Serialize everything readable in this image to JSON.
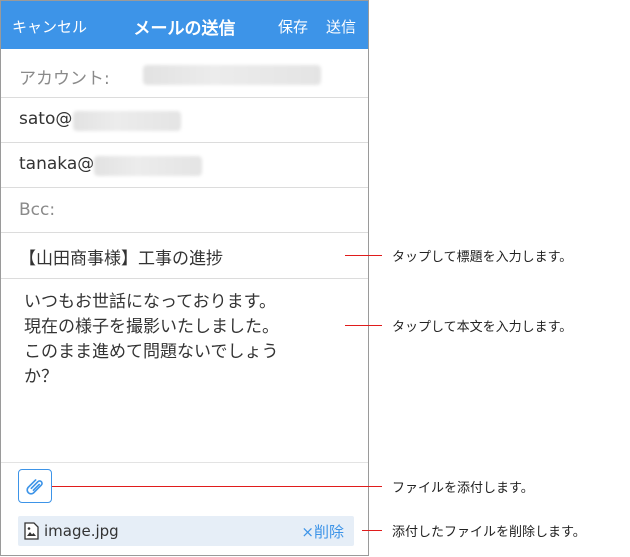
{
  "navbar": {
    "cancel_label": "キャンセル",
    "title": "メールの送信",
    "save_label": "保存",
    "send_label": "送信"
  },
  "fields": {
    "account_label": "アカウント:",
    "to_prefix": "sato@",
    "cc_prefix": "tanaka@",
    "bcc_label": "Bcc:"
  },
  "subject": "【山田商事様】工事の進捗",
  "body": "いつもお世話になっております。\n現在の様子を撮影いたしました。\nこのまま進めて問題ないでしょう\nか？",
  "attachment": {
    "file_name": "image.jpg",
    "delete_label": "×削除"
  },
  "callouts": {
    "subject": "タップして標題を入力します。",
    "body": "タップして本文を入力します。",
    "attach": "ファイルを添付します。",
    "delete": "添付したファイルを削除します。"
  },
  "colors": {
    "accent": "#3d94e8",
    "callout_line": "#e01c1c"
  }
}
